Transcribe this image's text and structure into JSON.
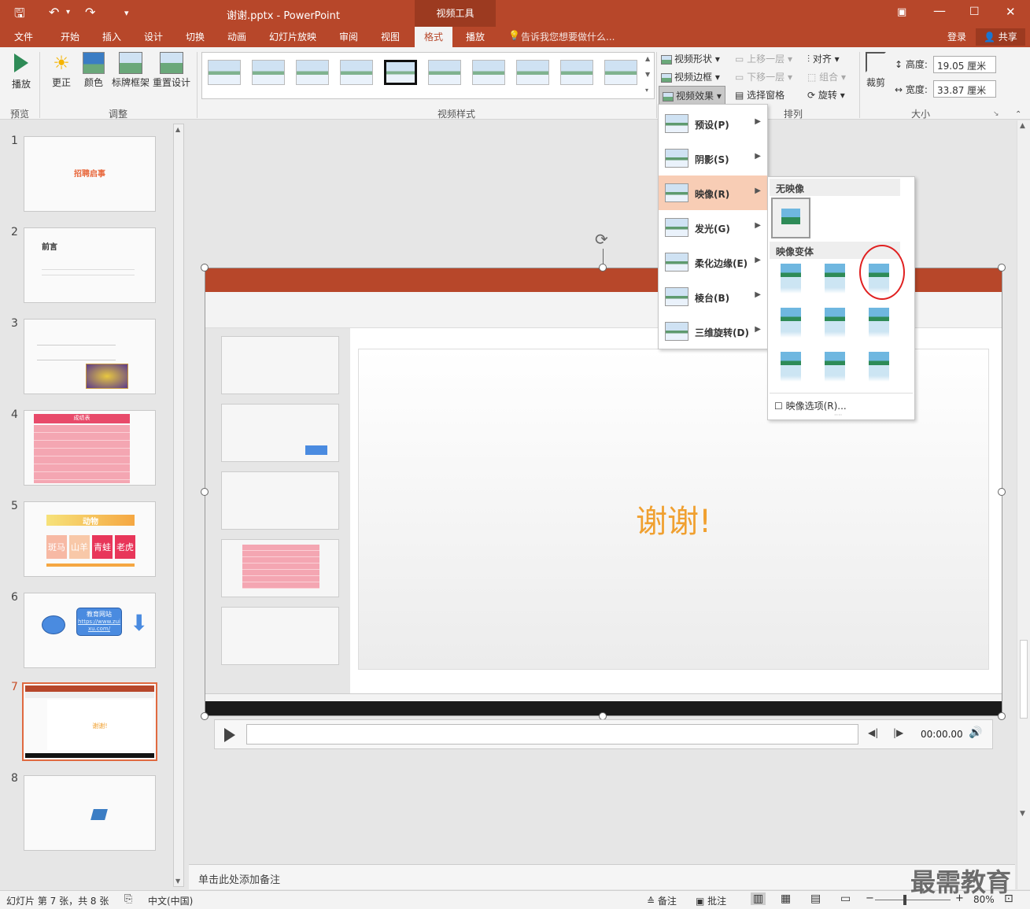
{
  "window": {
    "title": "谢谢.pptx - PowerPoint",
    "context_tab": "视频工具"
  },
  "tabs": [
    "文件",
    "开始",
    "插入",
    "设计",
    "切换",
    "动画",
    "幻灯片放映",
    "审阅",
    "视图",
    "格式",
    "播放"
  ],
  "active_tab": "格式",
  "tell_me": "告诉我您想要做什么...",
  "account": {
    "login": "登录",
    "share": "共享"
  },
  "ribbon": {
    "preview": {
      "play": "播放",
      "group": "预览"
    },
    "adjust": {
      "correct": "更正",
      "color": "颜色",
      "poster": "标牌框架",
      "reset": "重置设计",
      "group": "调整"
    },
    "styles_group": "视频样式",
    "video_shape": "视频形状",
    "video_border": "视频边框",
    "video_effects": "视频效果",
    "arrange": {
      "bring_forward": "上移一层",
      "send_backward": "下移一层",
      "selection_pane": "选择窗格",
      "align": "对齐",
      "group_btn": "组合",
      "rotate": "旋转",
      "group": "排列"
    },
    "crop": "裁剪",
    "size": {
      "height_label": "高度:",
      "height_value": "19.05 厘米",
      "width_label": "宽度:",
      "width_value": "33.87 厘米",
      "group": "大小"
    }
  },
  "effects_menu": [
    {
      "label": "预设(P)"
    },
    {
      "label": "阴影(S)"
    },
    {
      "label": "映像(R)"
    },
    {
      "label": "发光(G)"
    },
    {
      "label": "柔化边缘(E)"
    },
    {
      "label": "棱台(B)"
    },
    {
      "label": "三维旋转(D)"
    }
  ],
  "reflection_gallery": {
    "none_header": "无映像",
    "variants_header": "映像变体",
    "options": "映像选项(R)..."
  },
  "slides": [
    {
      "num": "1",
      "title": "招聘启事"
    },
    {
      "num": "2",
      "title": "前言"
    },
    {
      "num": "3",
      "title": ""
    },
    {
      "num": "4",
      "title": "成绩表"
    },
    {
      "num": "5",
      "title": "动物"
    },
    {
      "num": "6",
      "title": "教育网站"
    },
    {
      "num": "7",
      "title": "谢谢!"
    },
    {
      "num": "8",
      "title": ""
    }
  ],
  "slide5_cells": [
    "斑马",
    "山羊",
    "青蛙",
    "老虎"
  ],
  "slide6_link": "https://www.zuixu.com/",
  "main_slide_text": "谢谢!",
  "video": {
    "time": "00:00.00"
  },
  "notes_placeholder": "单击此处添加备注",
  "status": {
    "slide_info": "幻灯片 第 7 张，共 8 张",
    "language": "中文(中国)",
    "notes": "备注",
    "comments": "批注",
    "zoom": "80%"
  },
  "watermark": "最需教育",
  "colors": {
    "accent": "#b7472a",
    "highlight": "#f8cdb5",
    "slide_title": "#f0a030"
  }
}
